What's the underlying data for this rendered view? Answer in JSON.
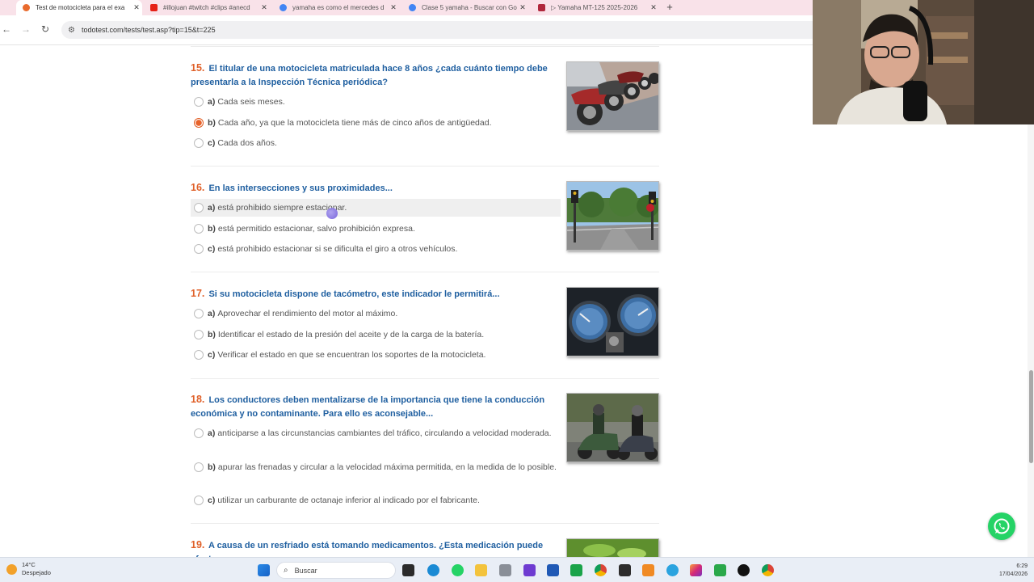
{
  "browser": {
    "tabs": [
      {
        "title": "Test de motocicleta para el exa",
        "active": true,
        "favicon_color": "#e96b2d"
      },
      {
        "title": "#illojuan #twitch #clips #anecd",
        "active": false,
        "favicon_color": "#e62117"
      },
      {
        "title": "yamaha es como el mercedes d",
        "active": false,
        "favicon_color": "#4285f4"
      },
      {
        "title": "Clase 5 yamaha - Buscar con Go",
        "active": false,
        "favicon_color": "#4285f4"
      },
      {
        "title": "▷ Yamaha MT-125 2025-2026",
        "active": false,
        "favicon_color": "#b0273c"
      }
    ],
    "url": "todotest.com/tests/test.asp?tip=15&t=225"
  },
  "questions": [
    {
      "number": "15.",
      "text": "El titular de una motocicleta matriculada hace 8 años ¿cada cuánto tiempo debe presentarla a la Inspección Técnica periódica?",
      "image": "parked-motorcycles",
      "options": [
        {
          "letter": "a)",
          "text": "Cada seis meses.",
          "selected": false
        },
        {
          "letter": "b)",
          "text": "Cada año, ya que la motocicleta tiene más de cinco años de antigüedad.",
          "selected": true
        },
        {
          "letter": "c)",
          "text": "Cada dos años.",
          "selected": false
        }
      ]
    },
    {
      "number": "16.",
      "text": "En las intersecciones y sus proximidades...",
      "image": "intersection",
      "options": [
        {
          "letter": "a)",
          "text": "está prohibido siempre estacionar.",
          "selected": false
        },
        {
          "letter": "b)",
          "text": "está permitido estacionar, salvo prohibición expresa.",
          "selected": false
        },
        {
          "letter": "c)",
          "text": "está prohibido estacionar si se dificulta el giro a otros vehículos.",
          "selected": false
        }
      ]
    },
    {
      "number": "17.",
      "text": "Si su motocicleta dispone de tacómetro, este indicador le permitirá...",
      "image": "tachometer",
      "options": [
        {
          "letter": "a)",
          "text": "Aprovechar el rendimiento del motor al máximo.",
          "selected": false
        },
        {
          "letter": "b)",
          "text": "Identificar el estado de la presión del aceite y de la carga de la batería.",
          "selected": false
        },
        {
          "letter": "c)",
          "text": "Verificar el estado en que se encuentran los soportes de la motocicleta.",
          "selected": false
        }
      ]
    },
    {
      "number": "18.",
      "text": "Los conductores deben mentalizarse de la importancia que tiene la conducción económica y no contaminante. Para ello es aconsejable...",
      "image": "scooter-riders",
      "options": [
        {
          "letter": "a)",
          "text": "anticiparse a las circunstancias cambiantes del tráfico, circulando a velocidad moderada.",
          "selected": false
        },
        {
          "letter": "b)",
          "text": "apurar las frenadas y circular a la velocidad máxima permitida, en la medida de lo posible.",
          "selected": false
        },
        {
          "letter": "c)",
          "text": "utilizar un carburante de octanaje inferior al indicado por el fabricante.",
          "selected": false
        }
      ]
    },
    {
      "number": "19.",
      "text": "A causa de un resfriado está tomando medicamentos. ¿Esta medicación puede afectar a",
      "image": "pills",
      "options": []
    }
  ],
  "taskbar": {
    "weather_temp": "14°C",
    "weather_desc": "Despejado",
    "search_placeholder": "Buscar",
    "time": "6:29",
    "date": "17/04/2026"
  }
}
